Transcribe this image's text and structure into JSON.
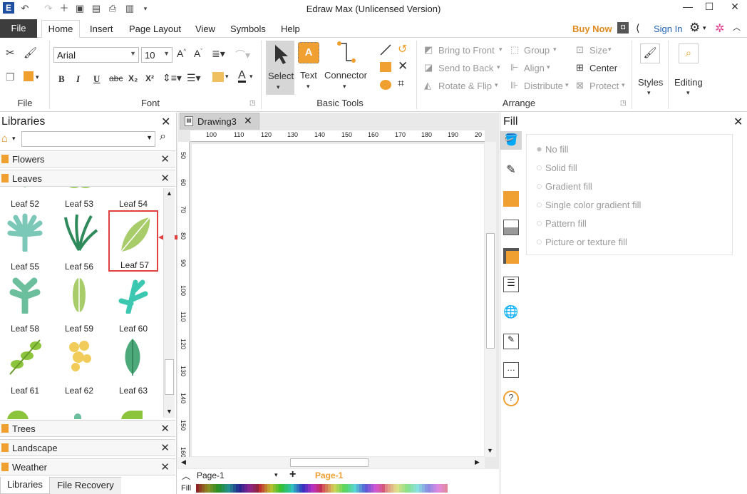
{
  "window": {
    "title": "Edraw Max (Unlicensed Version)"
  },
  "menu": {
    "file": "File",
    "tabs": [
      "Home",
      "Insert",
      "Page Layout",
      "View",
      "Symbols",
      "Help"
    ],
    "buy_now": "Buy Now",
    "sign_in": "Sign In"
  },
  "ribbon": {
    "font_name": "Arial",
    "font_size": "10",
    "groups": {
      "file": "File",
      "font": "Font",
      "basic_tools": "Basic Tools",
      "arrange": "Arrange"
    },
    "tools": {
      "select": "Select",
      "text": "Text",
      "connector": "Connector",
      "styles": "Styles",
      "editing": "Editing"
    },
    "arrange": {
      "bring_to_front": "Bring to Front",
      "send_to_back": "Send to Back",
      "rotate_flip": "Rotate & Flip",
      "group": "Group",
      "align": "Align",
      "distribute": "Distribute",
      "size": "Size",
      "center": "Center",
      "protect": "Protect"
    },
    "format_buttons": {
      "bold": "B",
      "italic": "I",
      "underline": "U",
      "strike": "abc",
      "subscript": "X₂",
      "superscript": "X²"
    }
  },
  "libraries": {
    "title": "Libraries",
    "categories_top": [
      "Flowers",
      "Leaves"
    ],
    "categories_bottom": [
      "Trees",
      "Landscape",
      "Weather"
    ],
    "leaf_rows": [
      [
        "Leaf 52",
        "Leaf 53",
        "Leaf 54"
      ],
      [
        "Leaf 55",
        "Leaf 56",
        "Leaf 57"
      ],
      [
        "Leaf 58",
        "Leaf 59",
        "Leaf 60"
      ],
      [
        "Leaf 61",
        "Leaf 62",
        "Leaf 63"
      ]
    ],
    "bottom_tabs": [
      "Libraries",
      "File Recovery"
    ]
  },
  "canvas": {
    "doc_tab": "Drawing3",
    "ruler_h": [
      "100",
      "110",
      "120",
      "130",
      "140",
      "150",
      "160",
      "170",
      "180",
      "190",
      "20"
    ],
    "ruler_v": [
      "50",
      "60",
      "70",
      "80",
      "90",
      "100",
      "110",
      "120",
      "130",
      "140",
      "150",
      "160"
    ],
    "page_selector": "Page-1",
    "page_tab": "Page-1",
    "fill_label": "Fill"
  },
  "fill_panel": {
    "title": "Fill",
    "options": [
      "No fill",
      "Solid fill",
      "Gradient fill",
      "Single color gradient fill",
      "Pattern fill",
      "Picture or texture fill"
    ]
  },
  "colors": {
    "accent_orange": "#f0a030",
    "highlight_red": "#e04040",
    "file_tab": "#3d3d3d"
  },
  "icons": [
    "app-logo-icon",
    "undo-icon",
    "redo-icon",
    "new-icon",
    "open-icon",
    "save-icon",
    "print-icon",
    "export-icon",
    "select-arrow-icon",
    "text-icon",
    "connector-icon",
    "styles-icon",
    "editing-search-icon",
    "search-icon",
    "home-icon",
    "red-arrow-icon"
  ]
}
